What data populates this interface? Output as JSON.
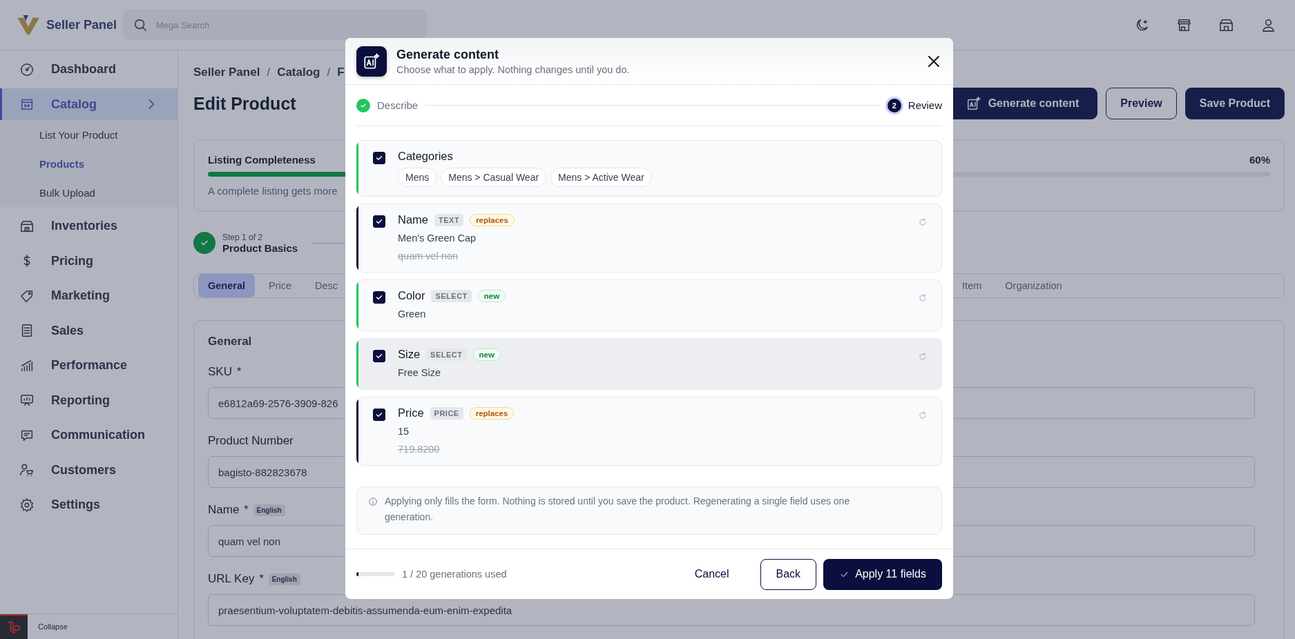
{
  "header": {
    "brand": "Seller Panel",
    "search": {
      "placeholder": "Mega Search"
    }
  },
  "sidebar": {
    "items": [
      {
        "label": "Dashboard",
        "selected": false
      },
      {
        "label": "Catalog",
        "selected": true,
        "expanded": true,
        "children": [
          {
            "label": "List Your Product",
            "selected": false
          },
          {
            "label": "Products",
            "selected": true
          },
          {
            "label": "Bulk Upload",
            "selected": false
          }
        ]
      },
      {
        "label": "Inventories",
        "selected": false
      },
      {
        "label": "Pricing",
        "selected": false
      },
      {
        "label": "Marketing",
        "selected": false
      },
      {
        "label": "Sales",
        "selected": false
      },
      {
        "label": "Performance",
        "selected": false
      },
      {
        "label": "Reporting",
        "selected": false
      },
      {
        "label": "Communication",
        "selected": false
      },
      {
        "label": "Customers",
        "selected": false
      },
      {
        "label": "Settings",
        "selected": false
      }
    ],
    "collapse": "Collapse"
  },
  "breadcrumb": [
    {
      "kind": "link",
      "text": "Seller Panel"
    },
    {
      "kind": "separator",
      "text": "/"
    },
    {
      "kind": "link",
      "text": "Catalog"
    },
    {
      "kind": "separator",
      "text": "/"
    },
    {
      "kind": "link",
      "text": "F"
    }
  ],
  "page_title": "Edit Product",
  "actions": [
    {
      "label": "Generate content",
      "kind": "ai"
    },
    {
      "label": "Preview",
      "kind": "outline"
    },
    {
      "label": "Save Product",
      "kind": "primary"
    }
  ],
  "completeness": {
    "label": "Listing Completeness",
    "reading": "60%",
    "level": 0.6,
    "hint": "A complete listing gets more"
  },
  "steps": [
    {
      "caption": "Step 1 of 2",
      "title": "Product Basics",
      "done": true
    }
  ],
  "tabs": [
    {
      "label": "General",
      "selected": true
    },
    {
      "label": "Price",
      "selected": false
    },
    {
      "label": "Desc",
      "selected": false
    },
    {
      "label": "Item",
      "selected": false
    },
    {
      "label": "Organization",
      "selected": false
    }
  ],
  "general": {
    "title": "General",
    "fields": [
      {
        "label": "SKU",
        "mark": "*",
        "value": "e6812a69-2576-3909-826"
      },
      {
        "label": "Product Number",
        "value": "bagisto-882823678"
      },
      {
        "label": "Name",
        "mark": "*",
        "locale": "English",
        "value": "quam vel non"
      },
      {
        "label": "URL Key",
        "mark": "*",
        "locale": "English",
        "value": "praesentium-voluptatem-debitis-assumenda-eum-enim-expedita"
      }
    ]
  },
  "modal": {
    "title": "Generate content",
    "subtitle": "Choose what to apply. Nothing changes until you do.",
    "steps": [
      {
        "label": "Describe",
        "done": true,
        "current": false
      },
      {
        "label": "Review",
        "number": "2",
        "done": false,
        "current": true
      }
    ],
    "suggestions": [
      {
        "kind": "chips",
        "label": "Categories",
        "checked": true,
        "color": "#22c55e",
        "hovered": false,
        "chips": [
          "Mens",
          "Mens > Casual Wear",
          "Mens > Active Wear"
        ]
      },
      {
        "kind": "value",
        "label": "Name",
        "checked": true,
        "type": "TEXT",
        "color": "#0a0f3d",
        "badge": {
          "text": "replaces",
          "kind": "changed"
        },
        "hovered": false,
        "value": "Men's Green Cap",
        "old": "quam vel non"
      },
      {
        "kind": "value",
        "label": "Color",
        "checked": true,
        "type": "SELECT",
        "color": "#22c55e",
        "badge": {
          "text": "new",
          "kind": "added"
        },
        "hovered": false,
        "value": "Green"
      },
      {
        "kind": "value",
        "label": "Size",
        "checked": true,
        "type": "SELECT",
        "color": "#22c55e",
        "badge": {
          "text": "new",
          "kind": "added"
        },
        "hovered": true,
        "value": "Free Size"
      },
      {
        "kind": "value",
        "label": "Price",
        "checked": true,
        "type": "PRICE",
        "color": "#0a0f3d",
        "badge": {
          "text": "replaces",
          "kind": "changed"
        },
        "hovered": false,
        "value": "15",
        "old": "719.8200"
      }
    ],
    "note": "Applying only fills the form. Nothing is stored until you save the product. Regenerating a single field uses one generation.",
    "usage": {
      "level": 0.05,
      "text": "1 / 20 generations used"
    },
    "buttons": [
      {
        "label": "Cancel",
        "kind": "text"
      },
      {
        "label": "Back",
        "kind": "outline"
      },
      {
        "label": "Apply 11 fields",
        "kind": "primary"
      }
    ]
  }
}
